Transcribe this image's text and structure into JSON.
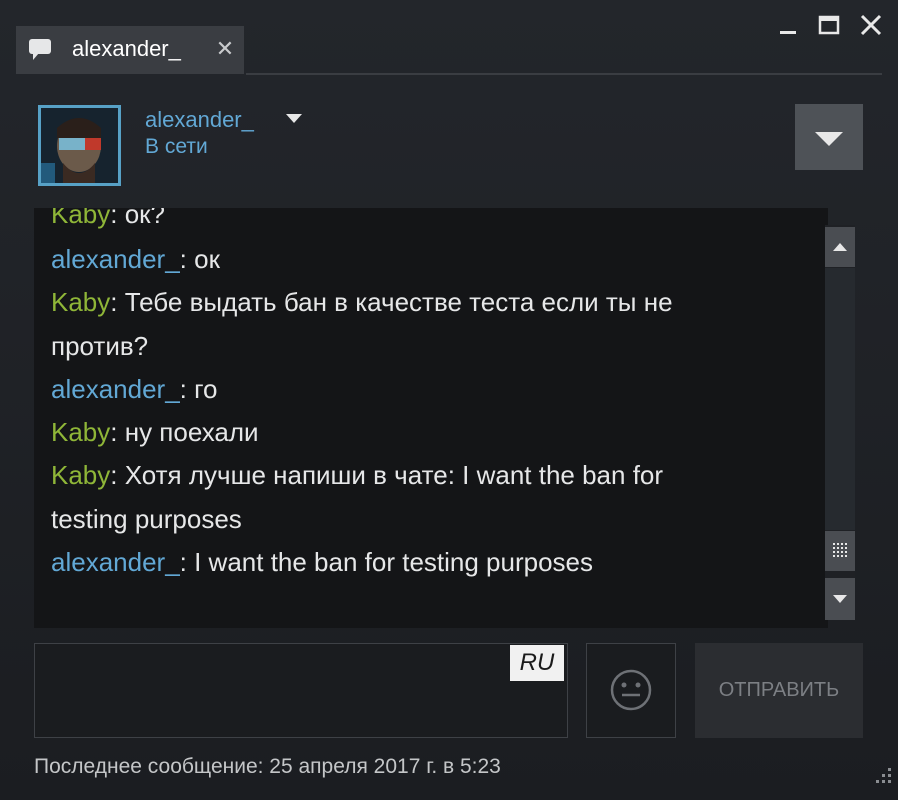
{
  "tab": {
    "label": "alexander_",
    "close": "✕",
    "icon": "chat-bubble-icon"
  },
  "window_controls": {
    "minimize_icon": "minimize-icon",
    "maximize_icon": "maximize-icon",
    "close_icon": "close-icon"
  },
  "header": {
    "name": "alexander_",
    "status": "В сети"
  },
  "messages": [
    {
      "author": "Kaby",
      "text": ": ок?"
    },
    {
      "author": "alexander_",
      "text": ": ок"
    },
    {
      "author": "Kaby",
      "text": ": Тебе выдать бан в качестве теста если ты не"
    },
    {
      "author": "",
      "text": "против?"
    },
    {
      "author": "alexander_",
      "text": ": го"
    },
    {
      "author": "Kaby",
      "text": ": ну поехали"
    },
    {
      "author": "Kaby",
      "text": ": Хотя лучше напиши в чате: I want the ban for"
    },
    {
      "author": "",
      "text": "testing purposes"
    },
    {
      "author": "alexander_",
      "text": ": I want the ban for testing purposes"
    }
  ],
  "input": {
    "language": "RU",
    "value": ""
  },
  "send_label": "ОТПРАВИТЬ",
  "footer": {
    "last_message": "Последнее сообщение: 25 апреля 2017 г. в 5:23"
  },
  "colors": {
    "own_name": "#62a8d5",
    "friend_name": "#8fb638",
    "chat_bg": "#141517"
  }
}
